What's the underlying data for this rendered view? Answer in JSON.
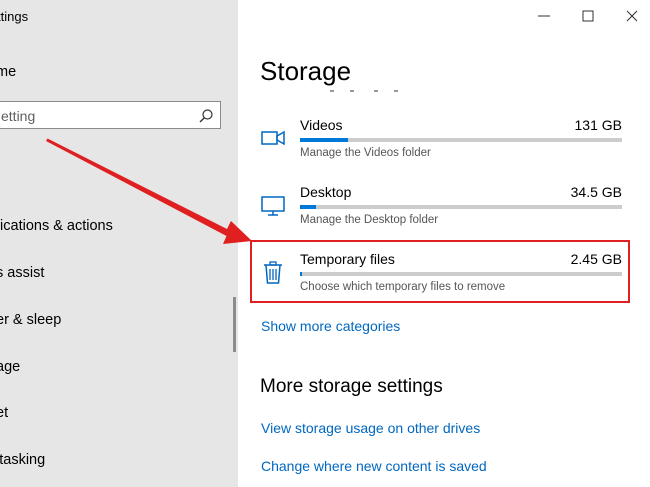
{
  "window": {
    "title": "ttings"
  },
  "sidebar": {
    "home": "me",
    "search_placeholder": "etting",
    "items": [
      {
        "label": "fications & actions"
      },
      {
        "label": "s assist"
      },
      {
        "label": "er & sleep"
      },
      {
        "label": "age"
      },
      {
        "label": "et"
      },
      {
        "label": "itasking"
      }
    ]
  },
  "main": {
    "title": "Storage",
    "storage_items": [
      {
        "name": "Videos",
        "size": "131 GB",
        "subtitle": "Manage the Videos folder",
        "icon": "video-icon",
        "usage_fraction": 0.15
      },
      {
        "name": "Desktop",
        "size": "34.5 GB",
        "subtitle": "Manage the Desktop folder",
        "icon": "monitor-icon",
        "usage_fraction": 0.05
      },
      {
        "name": "Temporary files",
        "size": "2.45 GB",
        "subtitle": "Choose which temporary files to remove",
        "icon": "trash-icon",
        "usage_fraction": 0.005
      }
    ],
    "show_more": "Show more categories",
    "more_title": "More storage settings",
    "links": [
      "View storage usage on other drives",
      "Change where new content is saved"
    ]
  },
  "colors": {
    "accent": "#0078d7",
    "link": "#0067c0",
    "highlight": "#e02020",
    "sidebar_bg": "#e6e6e6"
  }
}
